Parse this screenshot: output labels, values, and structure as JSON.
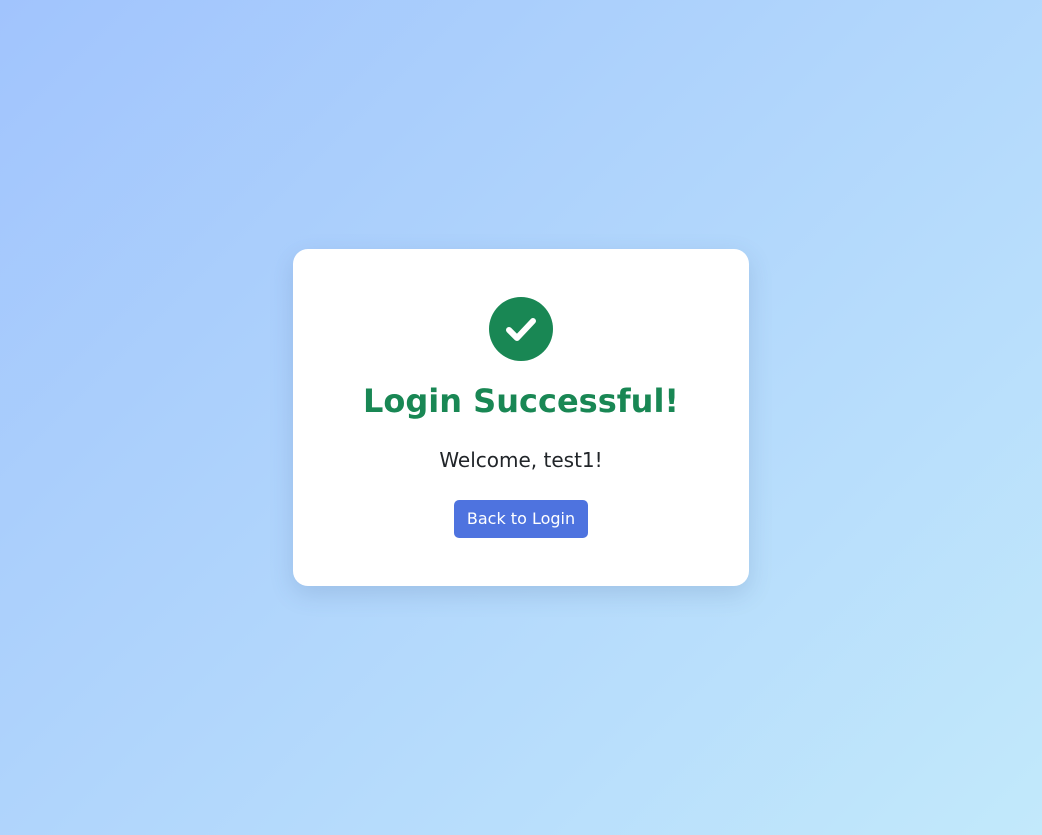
{
  "card": {
    "icon": "check-circle-icon",
    "title": "Login Successful!",
    "welcome": "Welcome, test1!",
    "back_button_label": "Back to Login"
  },
  "colors": {
    "success_green": "#198754",
    "button_blue": "#4e73df",
    "background_start": "#a1c4fd",
    "background_end": "#c2e9fb"
  }
}
